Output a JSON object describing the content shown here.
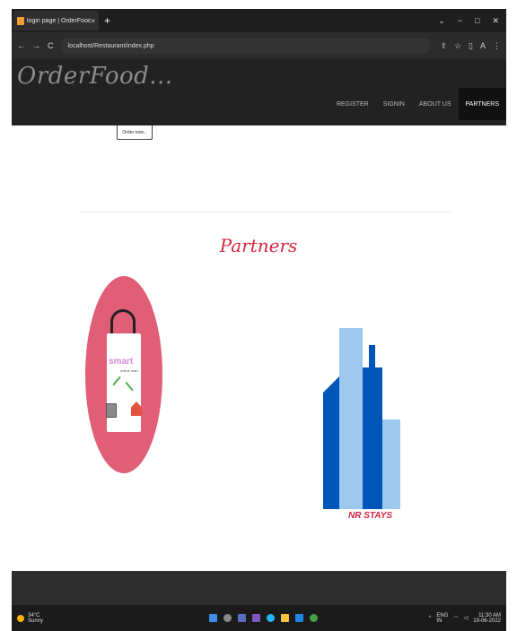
{
  "browser": {
    "tab": {
      "title": "login page | OrderFood...",
      "close": "×"
    },
    "new_tab": "+",
    "window_controls": [
      "⌄",
      "−",
      "□",
      "✕"
    ],
    "nav": [
      "←",
      "→",
      "C"
    ],
    "url": "localhost/Restaurant/index.php",
    "tools": [
      "⇪",
      "☆",
      "▯",
      "A",
      "⋮"
    ]
  },
  "site": {
    "logo": "OrderFood...",
    "nav": [
      "REGISTER",
      "SIGNIN",
      "ABOUT US",
      "PARTNERS"
    ],
    "active_nav": "PARTNERS",
    "order_button": "Order now..."
  },
  "main": {
    "heading": "Partners",
    "partners": [
      {
        "name": "smart",
        "subtitle": "online mart"
      },
      {
        "name": "NR STAYS"
      }
    ]
  },
  "taskbar": {
    "weather_temp": "34°C",
    "weather_desc": "Sunny",
    "lang": "ENG",
    "region": "IN",
    "time": "11:30 AM",
    "date": "19-06-2022"
  },
  "colors": {
    "accent": "#d6243f",
    "header_bg": "#222222",
    "smart_circle": "#e05e76",
    "nr_dark": "#0055b8",
    "nr_light": "#9fc8ee"
  }
}
